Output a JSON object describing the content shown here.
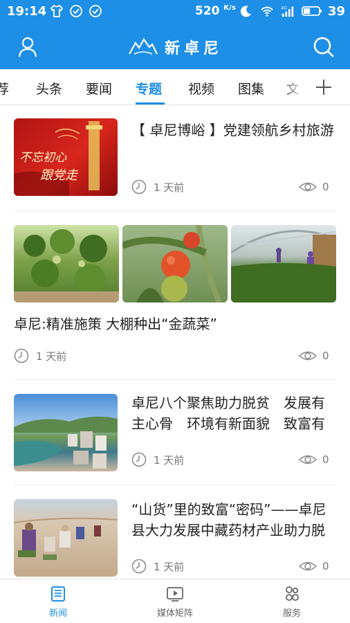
{
  "status_bar": {
    "time": "19:14",
    "net_speed": "520",
    "net_speed_unit": "K/s",
    "network_type": "4G",
    "battery": "39"
  },
  "header": {
    "title": "新卓尼"
  },
  "tabs": [
    {
      "label": "荐",
      "active": false
    },
    {
      "label": "头条",
      "active": false
    },
    {
      "label": "要闻",
      "active": false
    },
    {
      "label": "专题",
      "active": true
    },
    {
      "label": "视频",
      "active": false
    },
    {
      "label": "图集",
      "active": false
    },
    {
      "label": "文",
      "active": false
    }
  ],
  "news": [
    {
      "title": "【 卓尼博峪 】党建领航乡村旅游",
      "thumb_text_1": "不忘初心",
      "thumb_text_2": "跟党走",
      "time": "1 天前",
      "views": "0"
    },
    {
      "title": "卓尼:精准施策 大棚种出“金蔬菜”",
      "time": "1 天前",
      "views": "0"
    },
    {
      "title": "卓尼八个聚焦助力脱贫　发展有主心骨　环境有新面貌　致富有新门路",
      "time": "1 天前",
      "views": "0"
    },
    {
      "title": "“山货”里的致富“密码”——卓尼县大力发展中藏药材产业助力脱贫攻坚侧记",
      "time": "1 天前",
      "views": "0"
    }
  ],
  "bottom_nav": [
    {
      "label": "新闻",
      "icon": "news-icon",
      "active": true
    },
    {
      "label": "媒体矩阵",
      "icon": "media-icon",
      "active": false
    },
    {
      "label": "服务",
      "icon": "service-icon",
      "active": false
    }
  ],
  "colors": {
    "brand_blue": "#1e8fe6",
    "text_dark": "#222222",
    "text_meta": "#777777"
  }
}
